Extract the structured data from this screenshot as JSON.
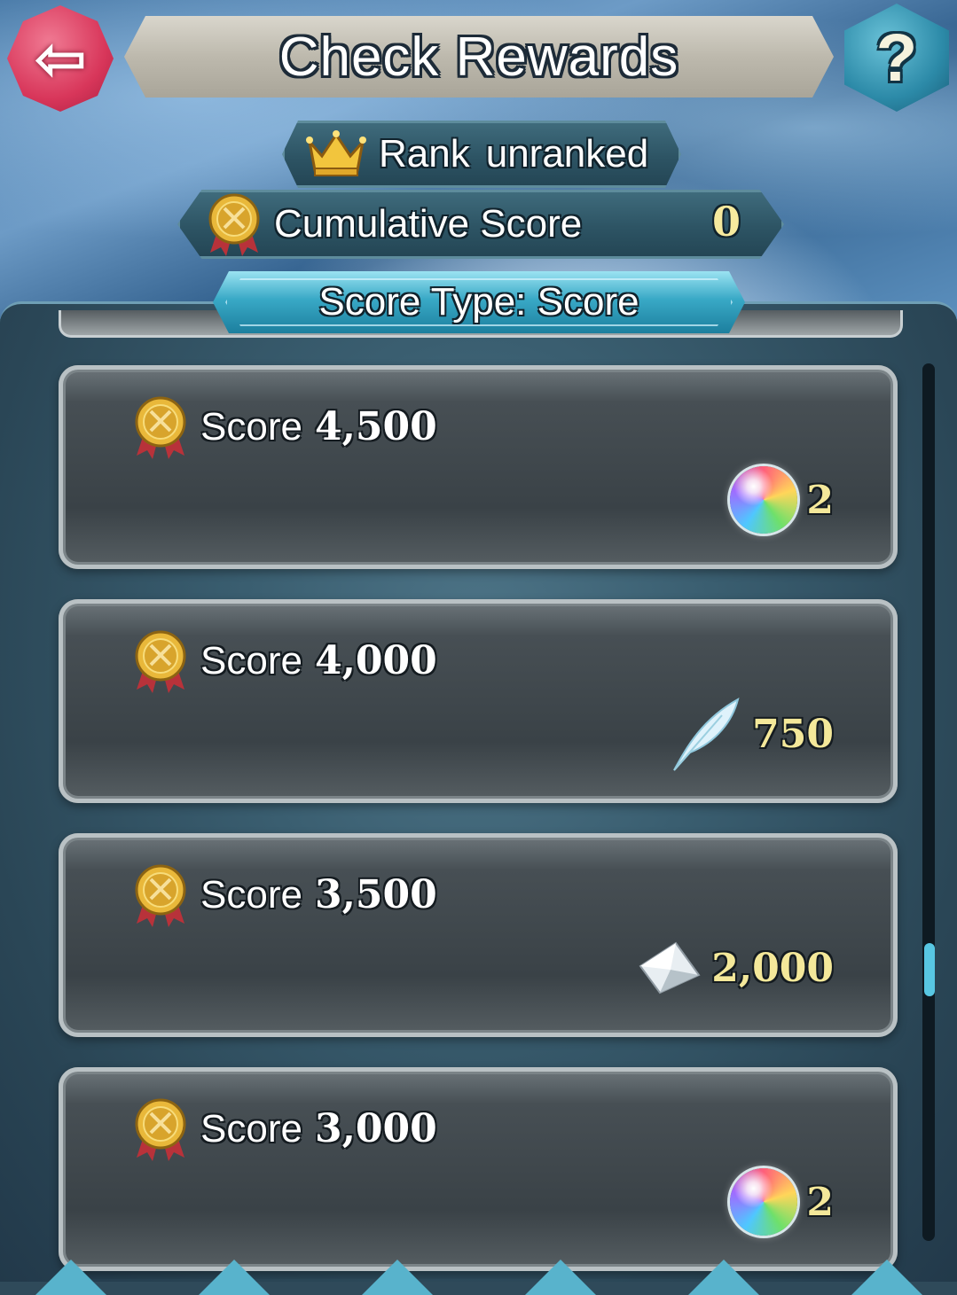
{
  "header": {
    "title": "Check Rewards",
    "back_icon": "left-arrow-icon",
    "help_label": "?"
  },
  "rank": {
    "label": "Rank",
    "value": "unranked"
  },
  "cumulative": {
    "label": "Cumulative Score",
    "value": "0"
  },
  "score_type": {
    "label": "Score Type: Score"
  },
  "rewards": [
    {
      "score_label": "Score",
      "score_value": "4,500",
      "reward_icon": "orb-icon",
      "reward_qty": "2"
    },
    {
      "score_label": "Score",
      "score_value": "4,000",
      "reward_icon": "feather-icon",
      "reward_qty": "750"
    },
    {
      "score_label": "Score",
      "score_value": "3,500",
      "reward_icon": "shard-icon",
      "reward_qty": "2,000"
    },
    {
      "score_label": "Score",
      "score_value": "3,000",
      "reward_icon": "orb-icon",
      "reward_qty": "2"
    }
  ],
  "colors": {
    "accent_gold": "#f4e89a",
    "back_button": "#d8365a",
    "help_button": "#2c8aa8",
    "tab_active": "#39a9c6"
  }
}
